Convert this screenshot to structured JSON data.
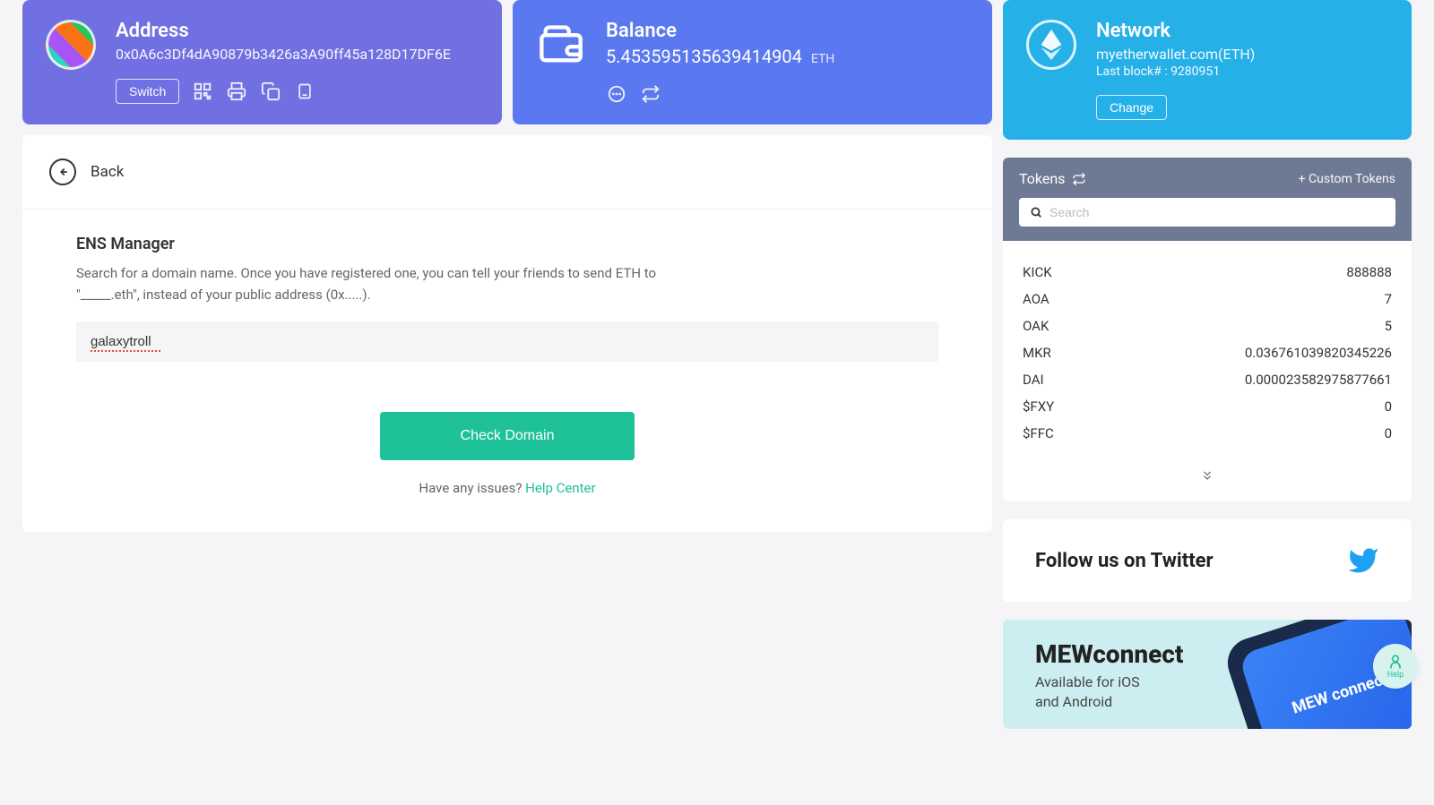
{
  "address_card": {
    "title": "Address",
    "value": "0x0A6c3Df4dA90879b3426a3A90ff45a128D17DF6E",
    "switch_label": "Switch"
  },
  "balance_card": {
    "title": "Balance",
    "amount": "5.453595135639414904",
    "currency": "ETH"
  },
  "network_card": {
    "title": "Network",
    "server": "myetherwallet.com(ETH)",
    "block_label": "Last block# : 9280951",
    "change_label": "Change"
  },
  "main": {
    "back_label": "Back",
    "ens_title": "ENS Manager",
    "ens_desc": "Search for a domain name. Once you have registered one, you can tell your friends to send ETH to \"_____.eth\", instead of your public address (0x.....).",
    "domain_value": "galaxytroll",
    "check_label": "Check Domain",
    "help_prefix": "Have any issues? ",
    "help_link": "Help Center"
  },
  "tokens": {
    "title": "Tokens",
    "custom_label": "+ Custom Tokens",
    "search_placeholder": "Search",
    "list": [
      {
        "sym": "KICK",
        "val": "888888"
      },
      {
        "sym": "AOA",
        "val": "7"
      },
      {
        "sym": "OAK",
        "val": "5"
      },
      {
        "sym": "MKR",
        "val": "0.036761039820345226"
      },
      {
        "sym": "DAI",
        "val": "0.000023582975877661"
      },
      {
        "sym": "$FXY",
        "val": "0"
      },
      {
        "sym": "$FFC",
        "val": "0"
      }
    ]
  },
  "twitter": {
    "text": "Follow us on Twitter"
  },
  "mew": {
    "title": "MEWconnect",
    "sub1": "Available for iOS",
    "sub2": "and Android",
    "phone_text": "MEW connect"
  },
  "help_widget": "Help"
}
